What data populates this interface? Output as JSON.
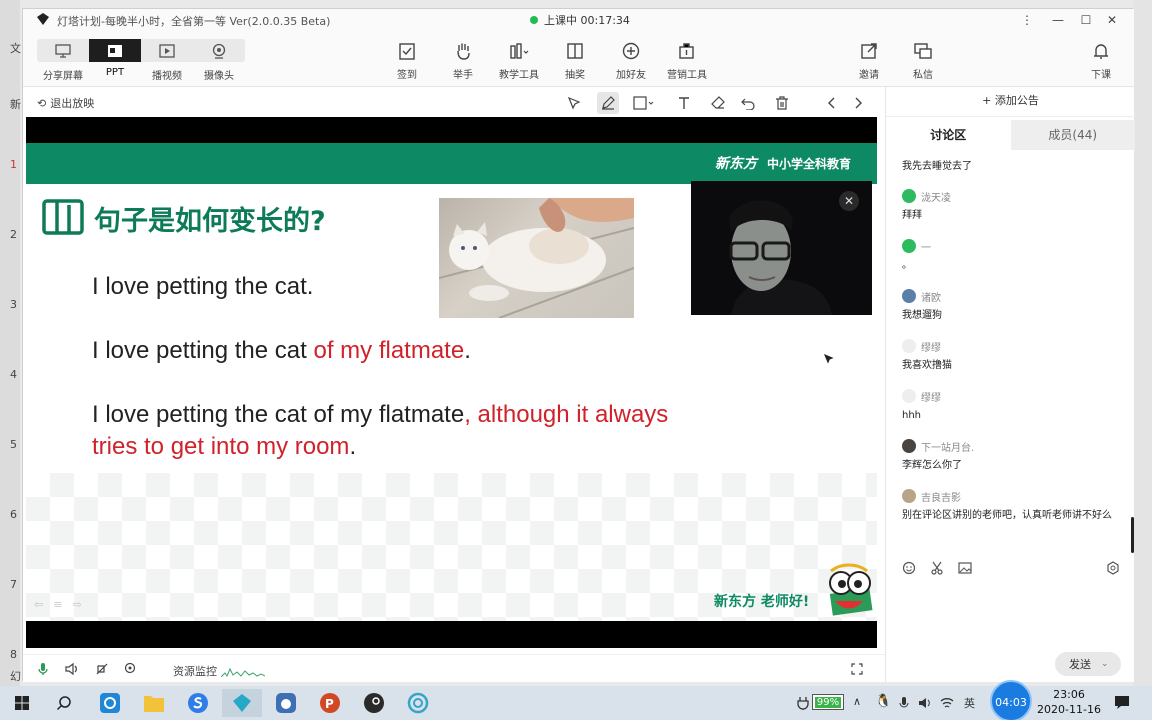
{
  "window": {
    "title": "灯塔计划-每晚半小时，全省第一等 Ver(2.0.0.35 Beta)",
    "live_status": "上课中 00:17:34",
    "controls": [
      "⋮",
      "—",
      "☐",
      "✕"
    ]
  },
  "modes": [
    {
      "label": "分享屏幕",
      "icon": "monitor-share-icon",
      "active": false
    },
    {
      "label": "PPT",
      "icon": "ppt-icon",
      "active": true
    },
    {
      "label": "播视频",
      "icon": "video-icon",
      "active": false
    },
    {
      "label": "摄像头",
      "icon": "camera-icon",
      "active": false
    }
  ],
  "tools": [
    {
      "label": "签到",
      "icon": "checkin-icon"
    },
    {
      "label": "举手",
      "icon": "hand-icon"
    },
    {
      "label": "教学工具",
      "icon": "teaching-tools-icon"
    },
    {
      "label": "抽奖",
      "icon": "lottery-icon"
    },
    {
      "label": "加好友",
      "icon": "add-friend-icon"
    },
    {
      "label": "营销工具",
      "icon": "marketing-tools-icon"
    },
    {
      "label": "邀请",
      "icon": "invite-icon"
    },
    {
      "label": "私信",
      "icon": "private-message-icon"
    },
    {
      "label": "下课",
      "icon": "end-class-icon"
    }
  ],
  "slidebar": {
    "exit_label": "退出放映",
    "tools": [
      "pointer-icon",
      "pen-icon",
      "rectangle-icon",
      "text-icon",
      "eraser-icon",
      "undo-icon",
      "trash-icon",
      "prev-icon",
      "next-icon"
    ]
  },
  "slide": {
    "brand_logo": "新东方",
    "brand_sub": "中小学全科教育",
    "heading": "句子是如何变长的?",
    "sentences": [
      {
        "plain": "I love petting the cat.",
        "red": "",
        "tail": ""
      },
      {
        "plain": "I love petting the cat ",
        "red": "of my flatmate",
        "tail": "."
      },
      {
        "plain": "I love petting the cat of my flatmate",
        "red": ", although it always tries to get into my room",
        "tail": "."
      }
    ],
    "footer_brand": "新东方 老师好!"
  },
  "bottombar": {
    "resource_label": "资源监控"
  },
  "panel": {
    "notice": "+ 添加公告",
    "tab_chat": "讨论区",
    "tab_members": "成员(44)",
    "messages": [
      {
        "name": "",
        "text": "我先去睡觉去了",
        "avatar": ""
      },
      {
        "name": "泷天凌",
        "text": "拜拜",
        "avatar": "wx"
      },
      {
        "name": "一",
        "text": "。",
        "avatar": "wx"
      },
      {
        "name": "诸欧",
        "text": "我想遛狗",
        "avatar": "photo"
      },
      {
        "name": "缪缪",
        "text": "我喜欢撸猫",
        "avatar": "plain"
      },
      {
        "name": "缪缪",
        "text": "hhh",
        "avatar": "plain"
      },
      {
        "name": "下一站月台.",
        "text": "李辉怎么你了",
        "avatar": "dark"
      },
      {
        "name": "吉良吉影",
        "text": "别在评论区讲别的老师吧，认真听老师讲不好么",
        "avatar": "photo"
      }
    ],
    "send_label": "发送",
    "chat_tools": [
      "emoji-icon",
      "scissors-icon",
      "image-icon",
      "settings-icon"
    ]
  },
  "taskbar": {
    "time": "23:06",
    "date": "2020-11-16",
    "battery": "99%",
    "bubble": "04:03",
    "ime": "英"
  },
  "desktop_strip": [
    "文",
    "新",
    "1",
    "2",
    "3",
    "4",
    "5",
    "6",
    "7",
    "8",
    "幻"
  ]
}
